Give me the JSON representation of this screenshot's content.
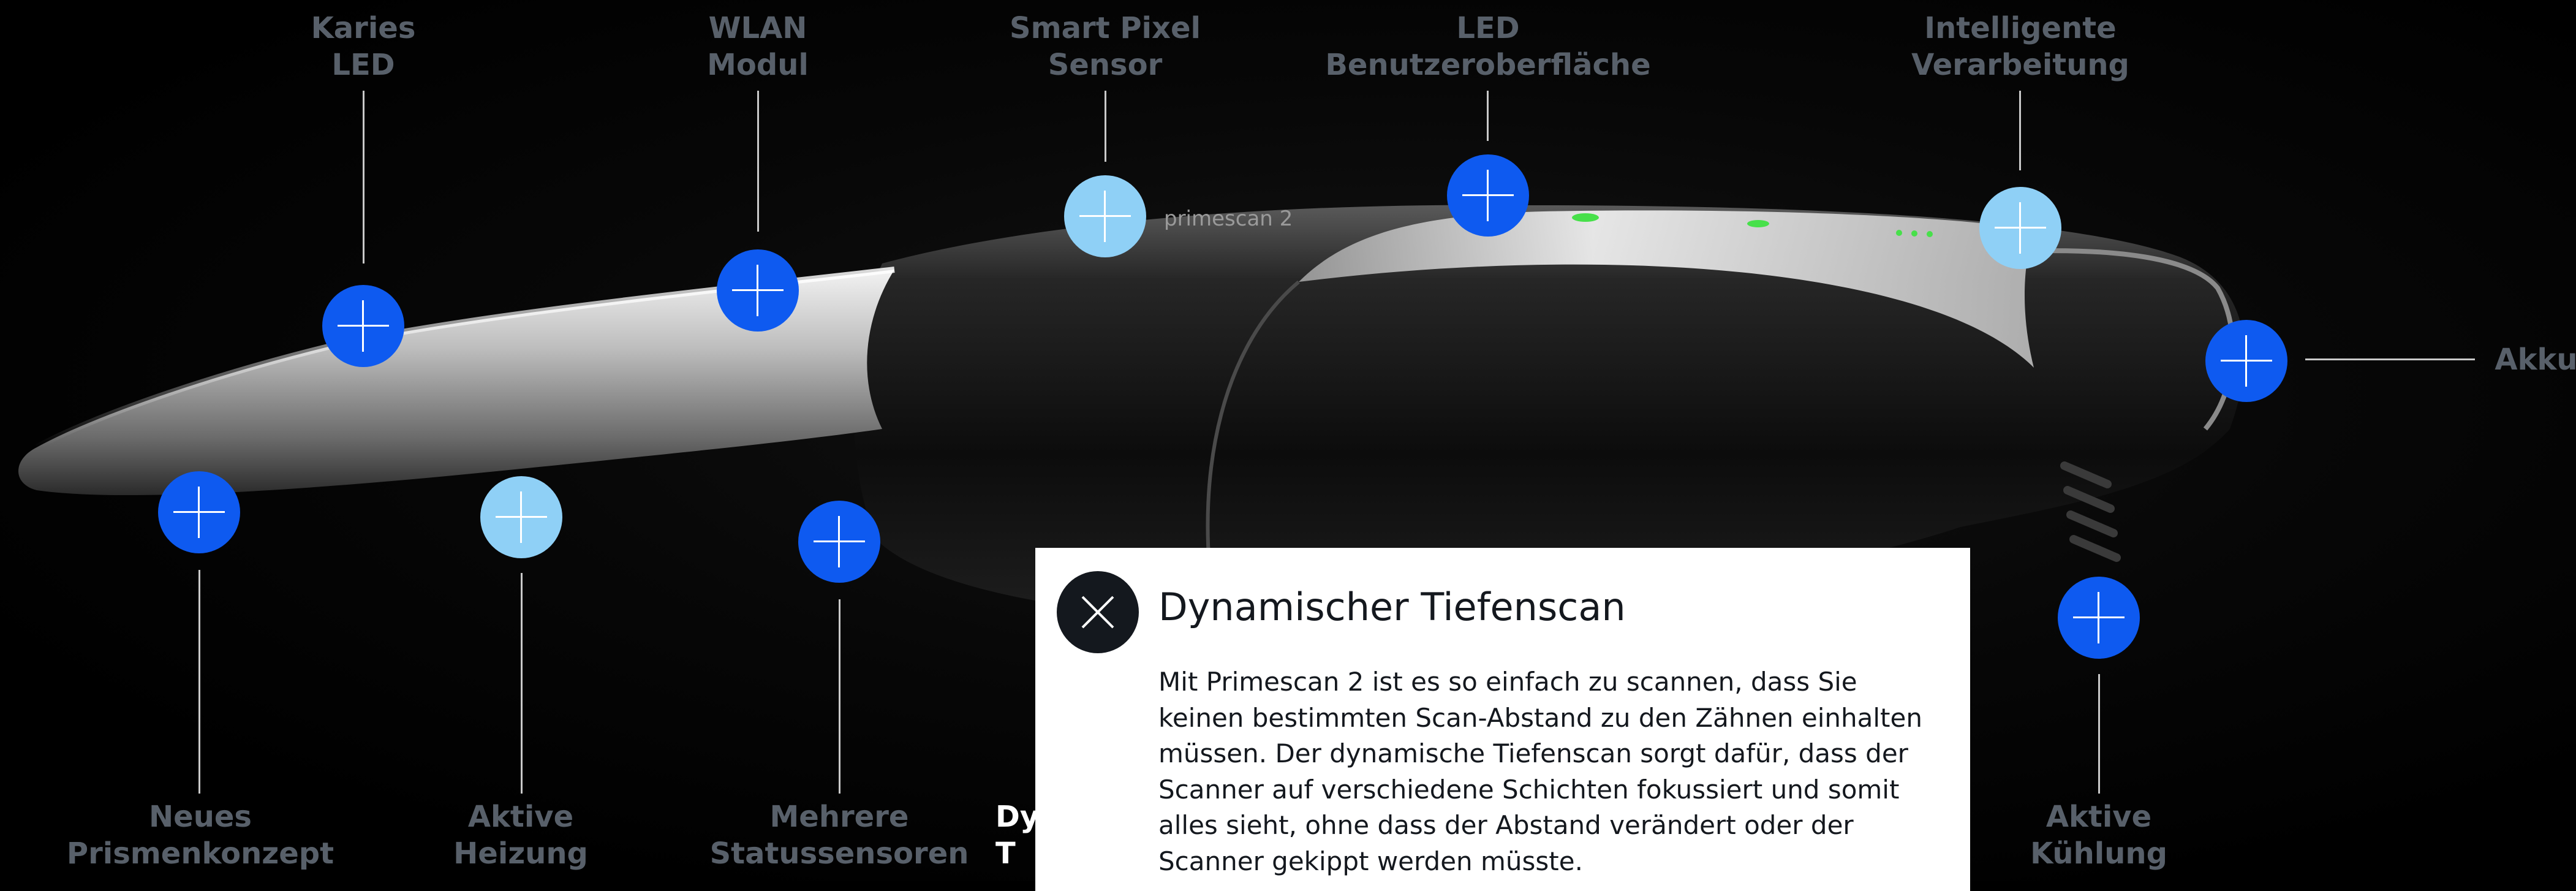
{
  "features": [
    {
      "label": "Karies\nLED",
      "active": false
    },
    {
      "label": "WLAN\nModul",
      "active": false
    },
    {
      "label": "Smart Pixel\nSensor",
      "active": false
    },
    {
      "label": "LED\nBenutzeroberfläche",
      "active": false
    },
    {
      "label": "Intelligente\nVerarbeitung",
      "active": false
    },
    {
      "label": "Akku",
      "active": false
    },
    {
      "label": "Neues\nPrismenkonzept",
      "active": false
    },
    {
      "label": "Aktive\nHeizung",
      "active": false
    },
    {
      "label": "Mehrere\nStatussensoren",
      "active": false
    },
    {
      "label": "Dy\nT",
      "active": true
    },
    {
      "label": "Aktive\nKühlung",
      "active": false
    }
  ],
  "hotspot_colors": {
    "default": "#0e5af0",
    "visited": "#8fd0f6"
  },
  "popup": {
    "title": "Dynamischer Tiefenscan",
    "body_lines": [
      "Mit Primescan 2 ist es so einfach zu scannen, dass Sie",
      "keinen bestimmten Scan-Abstand zu den Zähnen einhalten",
      "müssen. Der dynamische Tiefenscan sorgt dafür, dass der",
      "Scanner auf verschiedene Schichten fokussiert und somit",
      "alles sieht, ohne dass der Abstand verändert oder der",
      "Scanner gekippt werden müsste."
    ],
    "close_icon": "close-icon"
  },
  "device": {
    "engraving": "primescan 2"
  }
}
